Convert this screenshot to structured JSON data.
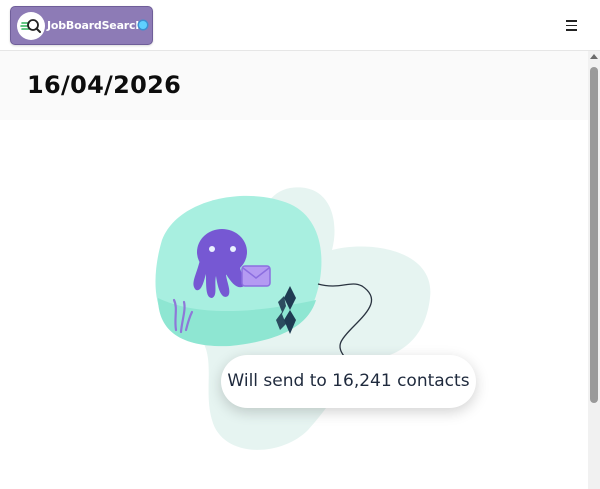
{
  "header": {
    "brand_name": "JobBoardSearch",
    "brand_color": "#8d7bb6",
    "logo_icon": "magnifier-logo-icon",
    "status_dot_color": "#5fd0ff",
    "menu_icon": "hamburger-icon"
  },
  "page": {
    "date_title": "16/04/2026"
  },
  "illustration": {
    "subject": "octopus-with-envelope-icon",
    "send_message": "Will send to 16,241 contacts"
  },
  "colors": {
    "octopus": "#7658d3",
    "blob_primary": "#a8efe0",
    "blob_secondary": "#e6f4f1"
  }
}
